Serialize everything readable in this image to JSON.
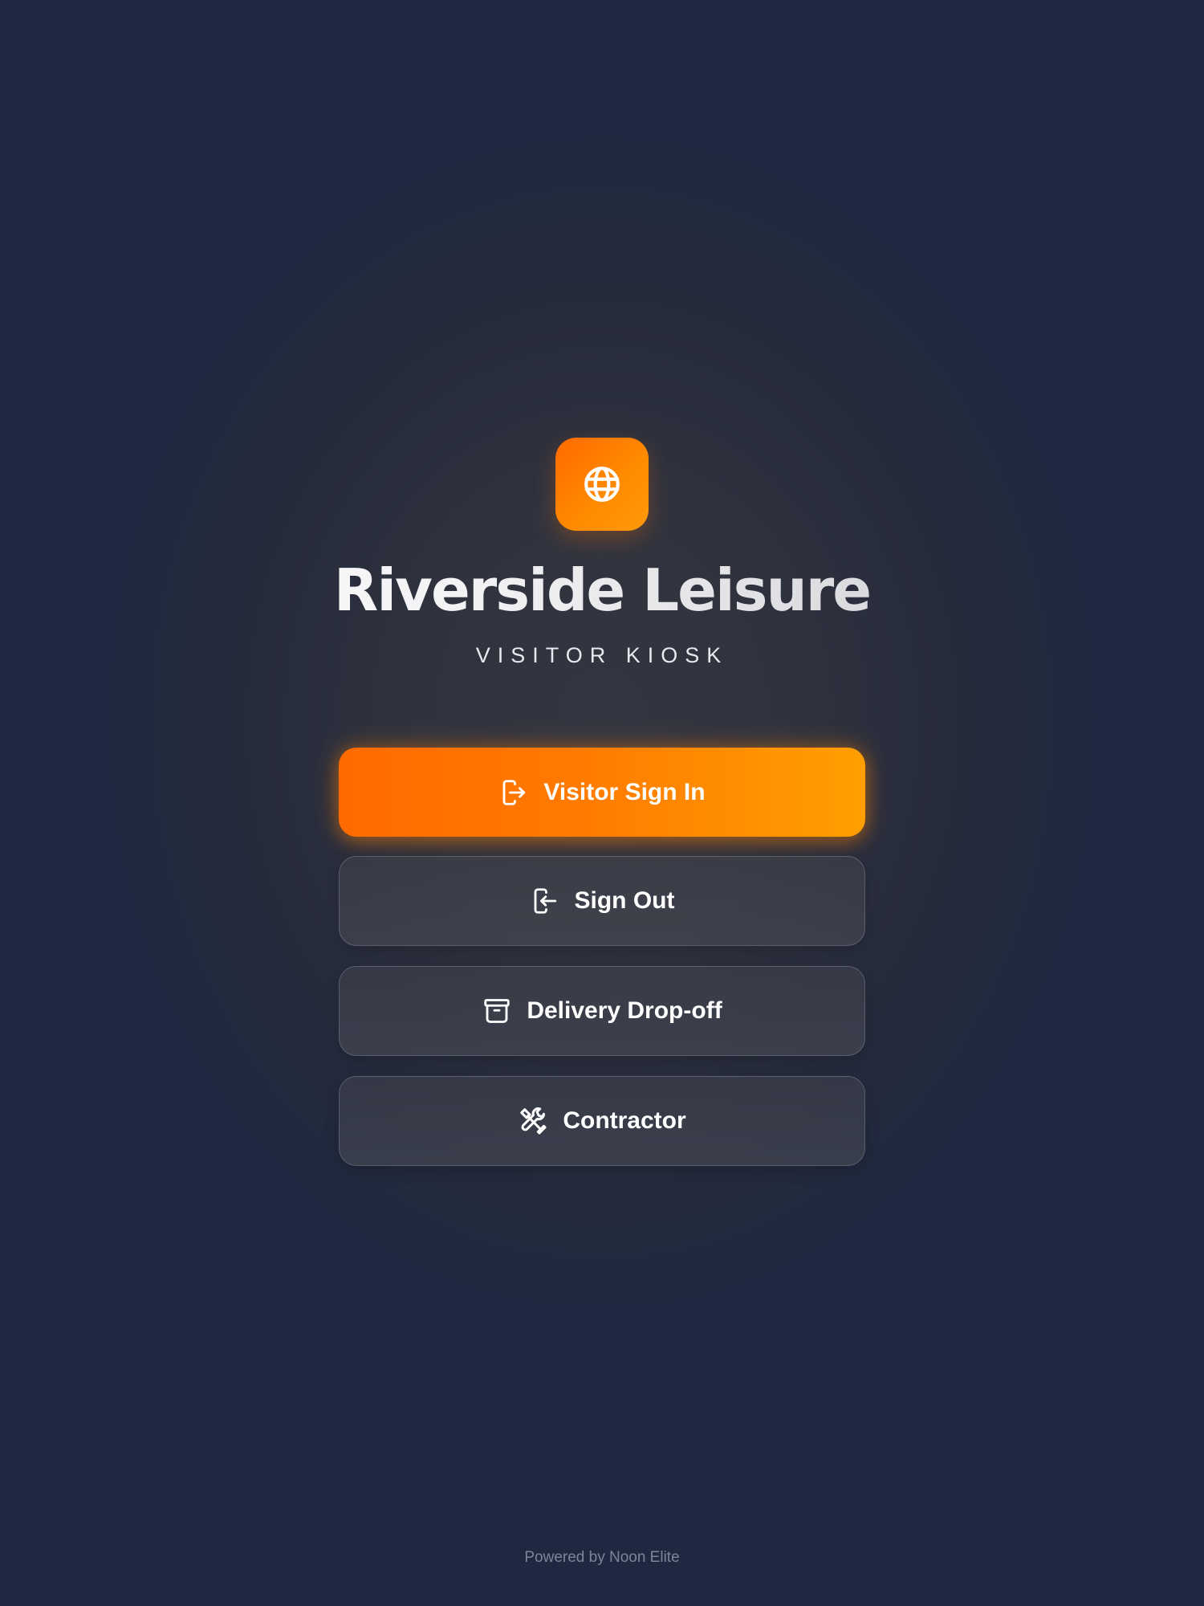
{
  "brand": {
    "name": "Riverside Leisure",
    "subtitle": "VISITOR KIOSK",
    "logo_icon": "globe-icon",
    "accent_color": "#ff7a00",
    "background_color": "#1e2840"
  },
  "actions": [
    {
      "label": "Visitor Sign In",
      "icon": "sign-in-icon",
      "style": "primary"
    },
    {
      "label": "Sign Out",
      "icon": "sign-out-icon",
      "style": "secondary"
    },
    {
      "label": "Delivery Drop-off",
      "icon": "archive-box-icon",
      "style": "secondary"
    },
    {
      "label": "Contractor",
      "icon": "tools-icon",
      "style": "secondary"
    }
  ],
  "footer": {
    "text": "Powered by Noon Elite"
  }
}
